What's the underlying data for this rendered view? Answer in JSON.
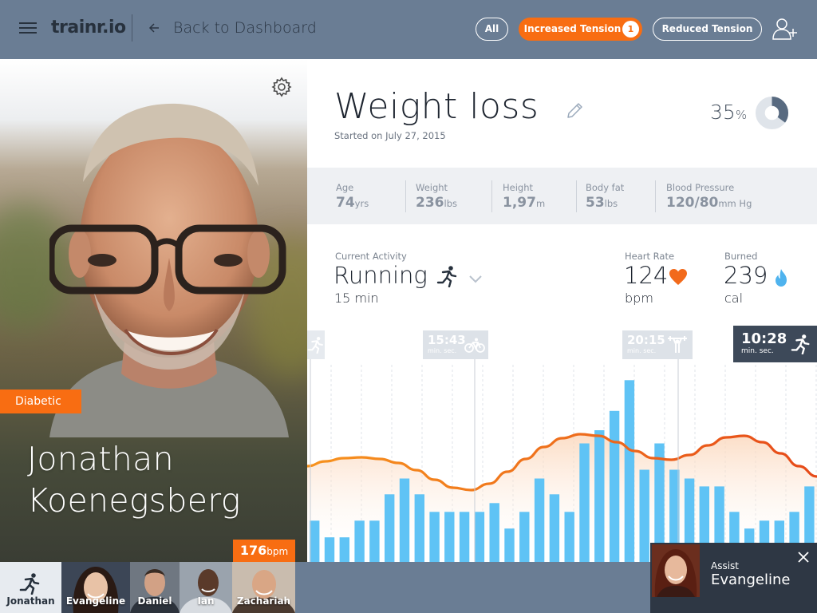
{
  "header": {
    "logo": "trainr.io",
    "back_label": "Back to Dashboard",
    "filters": {
      "all": "All",
      "increased": "Increased Tension",
      "increased_count": "1",
      "reduced": "Reduced Tension"
    }
  },
  "patient": {
    "tag": "Diabetic",
    "first_name": "Jonathan",
    "last_name": "Koenegsberg"
  },
  "goal": {
    "title": "Weight loss",
    "started": "Started on July 27, 2015",
    "progress_value": "35",
    "progress_unit": "%",
    "progress_fraction": 0.35
  },
  "stats": [
    {
      "label": "Age",
      "value": "74",
      "unit": "yrs"
    },
    {
      "label": "Weight",
      "value": "236",
      "unit": "lbs"
    },
    {
      "label": "Height",
      "value": "1,97",
      "unit": "m"
    },
    {
      "label": "Body fat",
      "value": "53",
      "unit": "lbs"
    },
    {
      "label": "Blood Pressure",
      "value": "120/80",
      "unit": "mm Hg"
    }
  ],
  "activity": {
    "label": "Current Activity",
    "value": "Running",
    "duration": "15 min",
    "heart_label": "Heart Rate",
    "heart_value": "124",
    "heart_unit": "bpm",
    "burned_label": "Burned",
    "burned_value": "239",
    "burned_unit": "cal"
  },
  "timeline": [
    {
      "time": "15:43",
      "min": "min.",
      "sec": "sec.",
      "icon": "bike-icon"
    },
    {
      "time": "20:15",
      "min": "min.",
      "sec": "sec.",
      "icon": "weights-icon"
    },
    {
      "time": "10:28",
      "min": "min.",
      "sec": "sec.",
      "icon": "run-icon"
    }
  ],
  "chart_data": {
    "type": "bar",
    "bars": [
      0.47,
      0.28,
      0.28,
      0.47,
      0.47,
      0.77,
      0.95,
      0.77,
      0.57,
      0.57,
      0.57,
      0.57,
      0.67,
      0.38,
      0.57,
      0.95,
      0.77,
      0.57,
      1.35,
      1.5,
      1.72,
      2.07,
      1.05,
      1.35,
      1.05,
      0.95,
      0.86,
      0.86,
      0.57,
      0.38,
      0.47,
      0.47,
      0.57,
      0.86
    ],
    "line": [
      0.6,
      0.66,
      0.7,
      0.71,
      0.69,
      0.64,
      0.55,
      0.43,
      0.33,
      0.3,
      0.38,
      0.53,
      0.69,
      0.84,
      0.95,
      1.0,
      0.98,
      0.9,
      0.79,
      0.7,
      0.68,
      0.74,
      0.86,
      0.96,
      0.98,
      0.9,
      0.76,
      0.6,
      0.47
    ],
    "colors": {
      "bar": "#5fc3f5",
      "line_start": "#f7931e",
      "line_end": "#e64a19"
    }
  },
  "patients_strip": [
    {
      "name": "Jonathan",
      "active": true
    },
    {
      "name": "Evangeline"
    },
    {
      "name": "Daniel"
    },
    {
      "name": "Ian"
    },
    {
      "name": "Zachariah",
      "bpm": "176",
      "bpm_unit": "bpm"
    }
  ],
  "assist": {
    "label": "Assist",
    "name": "Evangeline"
  }
}
